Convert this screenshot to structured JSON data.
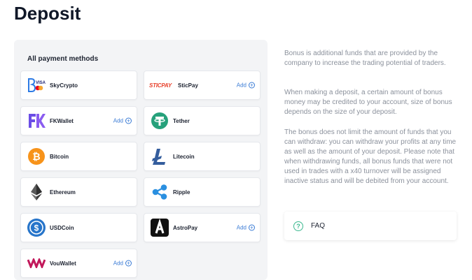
{
  "page": {
    "title": "Deposit"
  },
  "methods": {
    "heading": "All payment methods",
    "add_label": "Add",
    "items": [
      {
        "name": "SkyCrypto",
        "logo": "skycrypto-visa-mastercard-icon",
        "has_add": false
      },
      {
        "name": "SticPay",
        "logo": "sticpay-logo",
        "logo_text": "STICPAY",
        "has_add": true
      },
      {
        "name": "FKWallet",
        "logo": "fkwallet-logo-icon",
        "has_add": true
      },
      {
        "name": "Tether",
        "logo": "tether-icon",
        "has_add": false
      },
      {
        "name": "Bitcoin",
        "logo": "bitcoin-icon",
        "has_add": false
      },
      {
        "name": "Litecoin",
        "logo": "litecoin-icon",
        "has_add": false
      },
      {
        "name": "Ethereum",
        "logo": "ethereum-icon",
        "has_add": false
      },
      {
        "name": "Ripple",
        "logo": "ripple-icon",
        "has_add": false
      },
      {
        "name": "USDCoin",
        "logo": "usdcoin-icon",
        "has_add": false
      },
      {
        "name": "AstroPay",
        "logo": "astropay-icon",
        "has_add": true
      },
      {
        "name": "VouWallet",
        "logo": "vouwallet-icon",
        "has_add": true
      }
    ]
  },
  "info": {
    "paragraphs": [
      "Bonus is additional funds that are provided by the company to increase the trading potential of traders.",
      "When making a deposit, a certain amount of bonus money may be credited to your account, size of bonus depends on the size of your deposit.",
      "The bonus does not limit the amount of funds that you can withdraw: you can withdraw your profits at any time as well as the amount of your deposit. Please note that when withdrawing funds, all bonus funds that were not used in trades with a x40 turnover will be assigned inactive status and will be debited from your account."
    ]
  },
  "faq": {
    "label": "FAQ",
    "icon": "question-circle-icon"
  },
  "colors": {
    "accent_blue": "#3a7bd5",
    "faq_green": "#3cb88f",
    "panel_bg": "#f3f4f6",
    "info_text": "#8b919c"
  }
}
